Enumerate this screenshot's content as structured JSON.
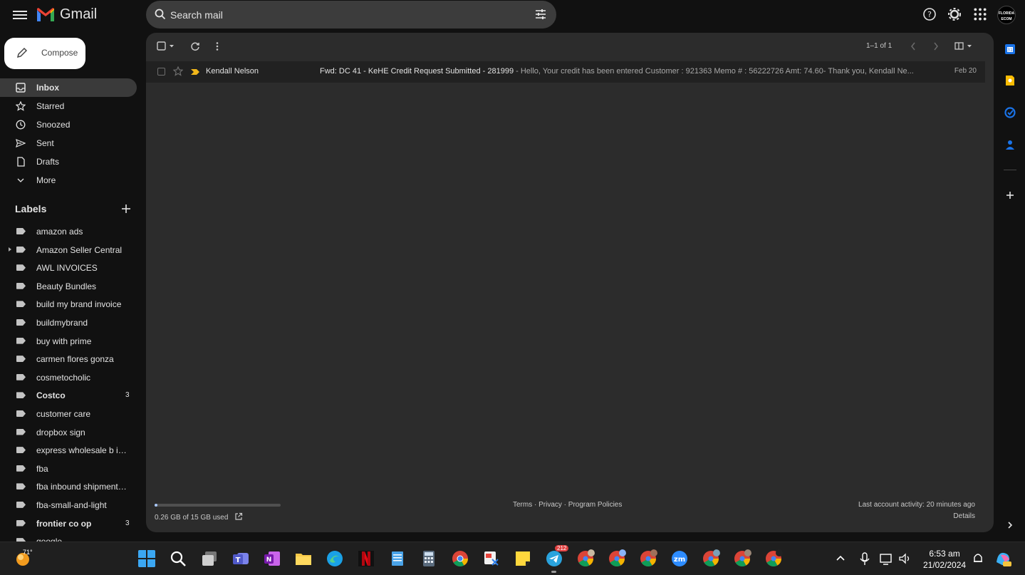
{
  "app": {
    "name": "Gmail"
  },
  "search": {
    "placeholder": "Search mail"
  },
  "compose": {
    "label": "Compose"
  },
  "nav": [
    {
      "label": "Inbox",
      "icon": "inbox-icon",
      "active": true
    },
    {
      "label": "Starred",
      "icon": "star-icon"
    },
    {
      "label": "Snoozed",
      "icon": "clock-icon"
    },
    {
      "label": "Sent",
      "icon": "send-icon"
    },
    {
      "label": "Drafts",
      "icon": "draft-icon"
    },
    {
      "label": "More",
      "icon": "chevron-down-icon"
    }
  ],
  "labels_heading": "Labels",
  "labels": [
    {
      "name": "amazon ads"
    },
    {
      "name": "Amazon Seller Central",
      "expandable": true
    },
    {
      "name": "AWL INVOICES"
    },
    {
      "name": "Beauty Bundles"
    },
    {
      "name": "build my brand invoice"
    },
    {
      "name": "buildmybrand"
    },
    {
      "name": "buy with prime"
    },
    {
      "name": "carmen flores gonza"
    },
    {
      "name": "cosmetocholic"
    },
    {
      "name": "Costco",
      "bold": true,
      "count": "3"
    },
    {
      "name": "customer care"
    },
    {
      "name": "dropbox sign"
    },
    {
      "name": "express wholesale b inv..."
    },
    {
      "name": "fba"
    },
    {
      "name": "fba inbound shipment b..."
    },
    {
      "name": "fba-small-and-light"
    },
    {
      "name": "frontier co op",
      "bold": true,
      "count": "3"
    },
    {
      "name": "google"
    }
  ],
  "toolbar": {
    "pager": "1–1 of 1"
  },
  "emails": [
    {
      "sender": "Kendall Nelson",
      "subject": "Fwd: DC 41 - KeHE Credit Request Submitted - 281999",
      "snippet": " - Hello, Your credit has been entered Customer : 921363 Memo # : 56222726 Amt: 74.60- Thank you, Kendall Ne...",
      "date": "Feb 20",
      "important": true
    }
  ],
  "footer": {
    "storage": "0.26 GB of 15 GB used",
    "storage_fraction": 0.017,
    "links": "Terms · Privacy · Program Policies",
    "activity": "Last account activity: 20 minutes ago",
    "details": "Details"
  },
  "taskbar": {
    "temperature": "71°",
    "telegram_badge": "212",
    "time": "6:53 am",
    "date": "21/02/2024"
  },
  "avatar_text": "FLORIDA ECOM",
  "colors": {
    "accent": "#a8c7fa",
    "compose_bg": "#ffffff",
    "important": "#f2b71a"
  }
}
